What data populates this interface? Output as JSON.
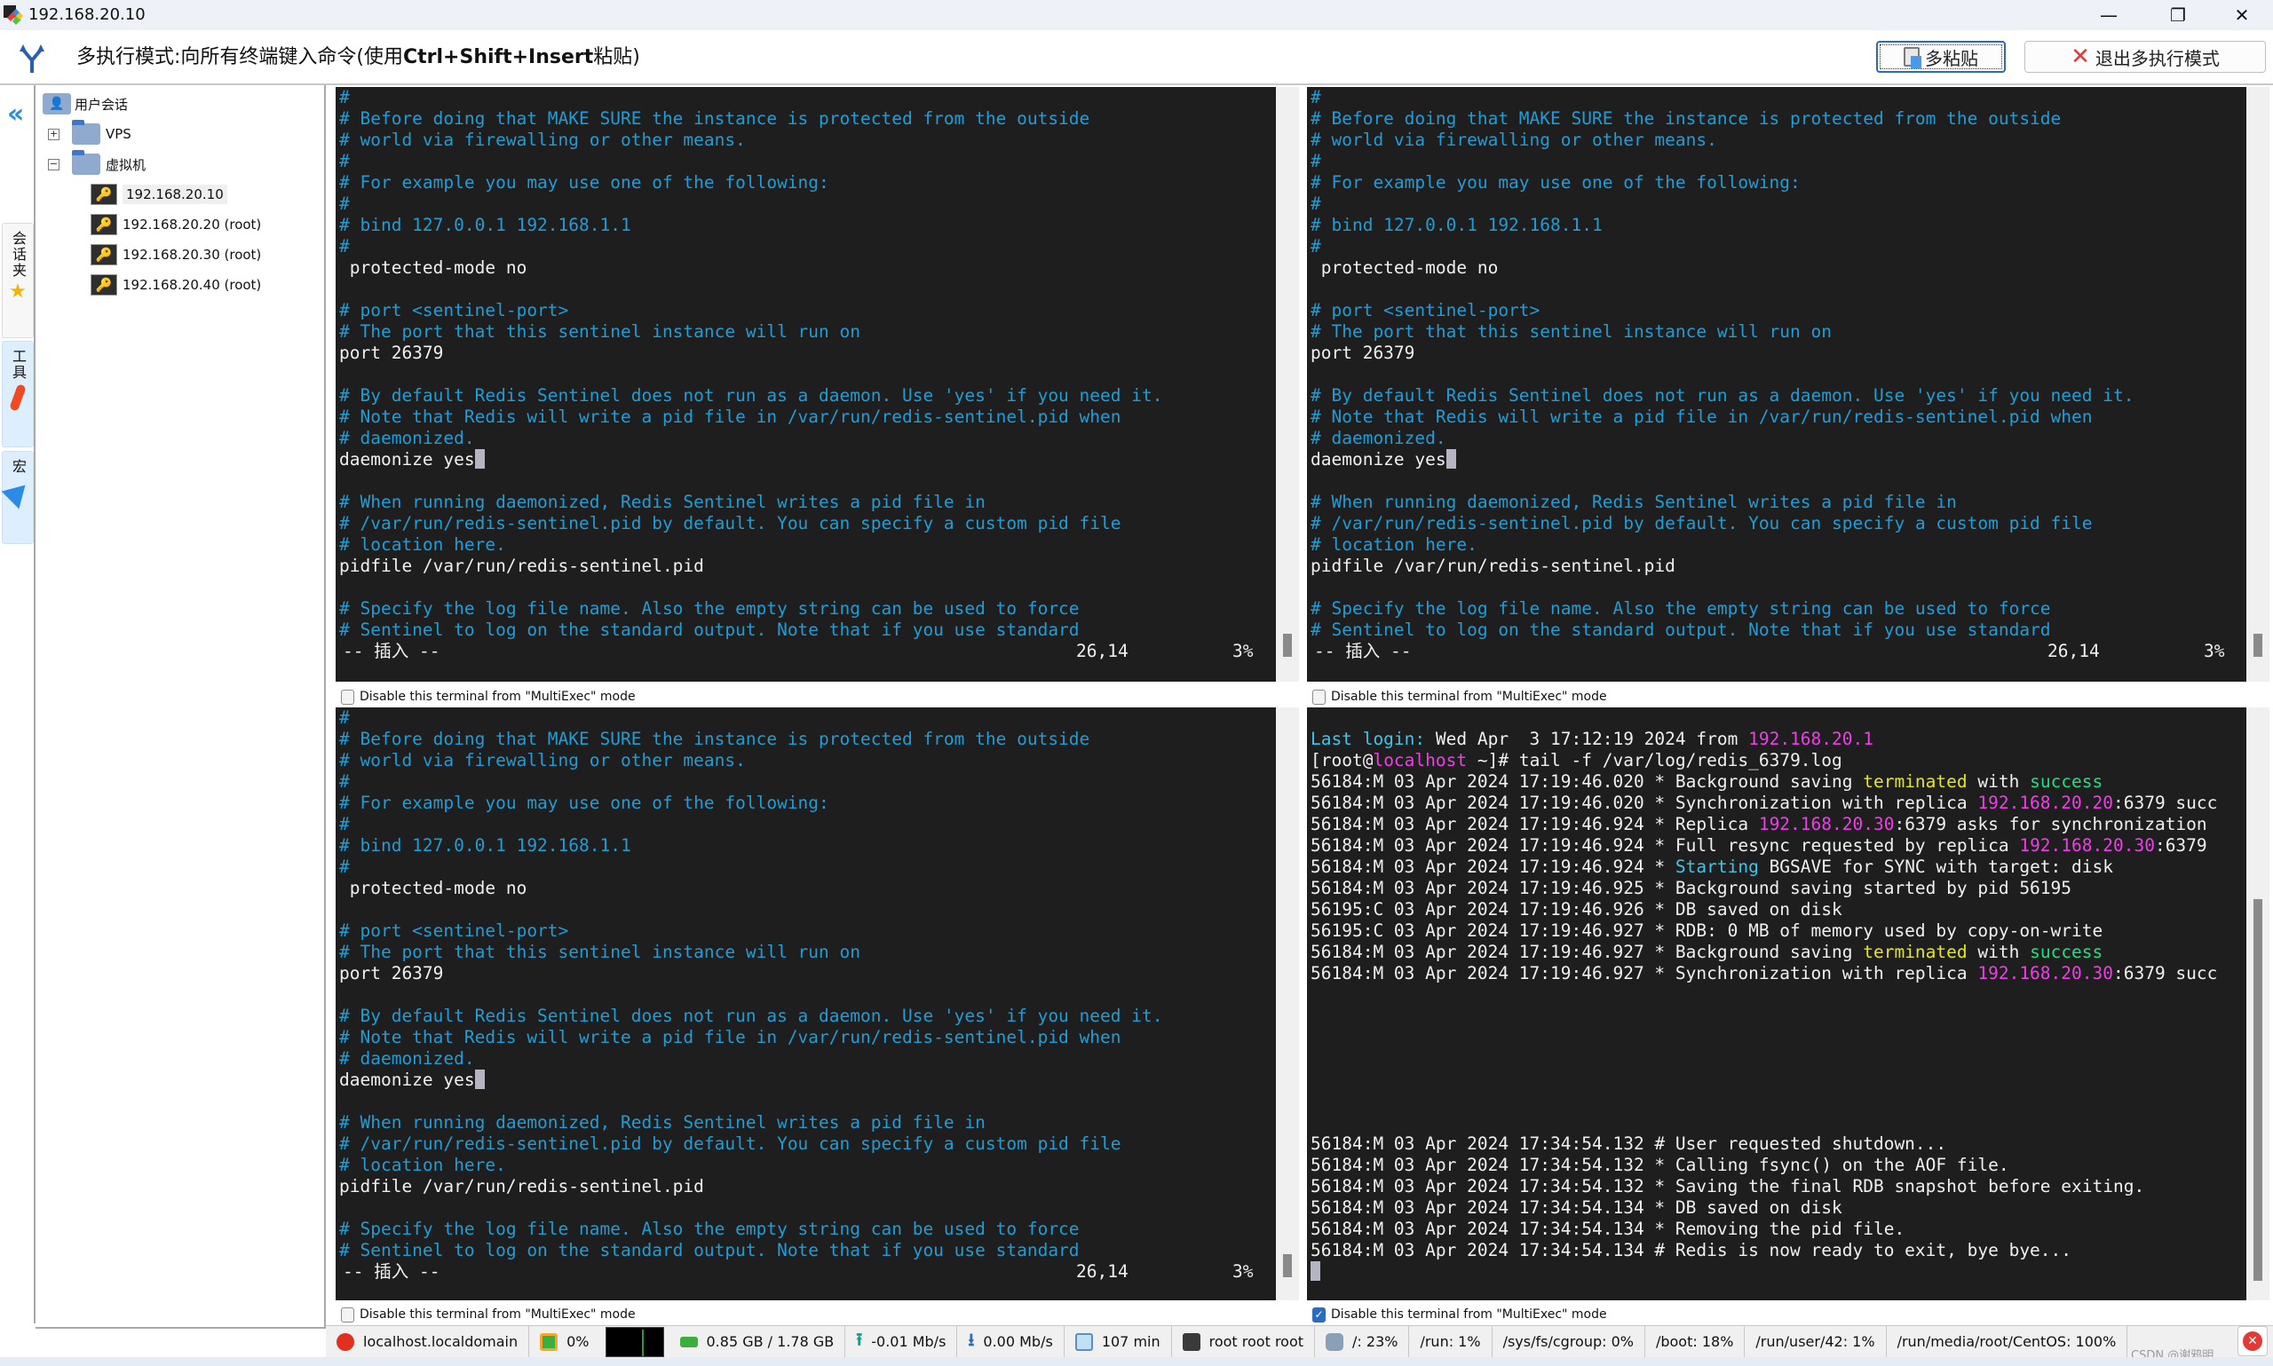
{
  "window": {
    "title": "192.168.20.10",
    "controls": {
      "minimize": "—",
      "maximize": "❐",
      "close": "✕"
    }
  },
  "banner": {
    "text_prefix": "多执行模式:向所有终端键入命令(使用",
    "text_bold": "Ctrl+Shift+Insert",
    "text_suffix": "粘贴)",
    "paste_button": "多粘贴",
    "exit_button": "退出多执行模式"
  },
  "vtabs": {
    "collapse": "«",
    "sessions": "会话夹",
    "tools": "工具",
    "macros": "宏"
  },
  "tree": {
    "root": "用户会话",
    "folders": [
      {
        "label": "VPS",
        "expander": "+"
      },
      {
        "label": "虚拟机",
        "expander": "−"
      }
    ],
    "sessions": [
      {
        "label": "192.168.20.10",
        "selected": true
      },
      {
        "label": "192.168.20.20 (root)",
        "selected": false
      },
      {
        "label": "192.168.20.30 (root)",
        "selected": false
      },
      {
        "label": "192.168.20.40 (root)",
        "selected": false
      }
    ]
  },
  "vim_pane": {
    "lines": [
      {
        "t": "#",
        "c": "cmt"
      },
      {
        "t": "# Before doing that MAKE SURE the instance is protected from the outside",
        "c": "cmt"
      },
      {
        "t": "# world via firewalling or other means.",
        "c": "cmt"
      },
      {
        "t": "#",
        "c": "cmt"
      },
      {
        "t": "# For example you may use one of the following:",
        "c": "cmt"
      },
      {
        "t": "#",
        "c": "cmt"
      },
      {
        "t": "# bind 127.0.0.1 192.168.1.1",
        "c": "cmt"
      },
      {
        "t": "#",
        "c": "cmt"
      },
      {
        "t": " protected-mode no",
        "c": ""
      },
      {
        "t": "",
        "c": ""
      },
      {
        "t": "# port <sentinel-port>",
        "c": "cmt"
      },
      {
        "t": "# The port that this sentinel instance will run on",
        "c": "cmt"
      },
      {
        "t": "port 26379",
        "c": ""
      },
      {
        "t": "",
        "c": ""
      },
      {
        "t": "# By default Redis Sentinel does not run as a daemon. Use 'yes' if you need it.",
        "c": "cmt"
      },
      {
        "t": "# Note that Redis will write a pid file in /var/run/redis-sentinel.pid when",
        "c": "cmt"
      },
      {
        "t": "# daemonized.",
        "c": "cmt"
      },
      {
        "t": "daemonize yes",
        "c": "",
        "cursor": true
      },
      {
        "t": "",
        "c": ""
      },
      {
        "t": "# When running daemonized, Redis Sentinel writes a pid file in",
        "c": "cmt"
      },
      {
        "t": "# /var/run/redis-sentinel.pid by default. You can specify a custom pid file",
        "c": "cmt"
      },
      {
        "t": "# location here.",
        "c": "cmt"
      },
      {
        "t": "pidfile /var/run/redis-sentinel.pid",
        "c": ""
      },
      {
        "t": "",
        "c": ""
      },
      {
        "t": "# Specify the log file name. Also the empty string can be used to force",
        "c": "cmt"
      },
      {
        "t": "# Sentinel to log on the standard output. Note that if you use standard",
        "c": "cmt"
      }
    ],
    "status_mode": "-- 插入 --",
    "status_pos": "26,14",
    "status_pct": "3%",
    "scroll_position": 0.03
  },
  "multiexec_checkbox": {
    "label": "Disable this terminal from \"MultiExec\" mode",
    "pane_1": false,
    "pane_2": false,
    "pane_3": false,
    "pane_4": true
  },
  "log_pane": {
    "lines": [
      [],
      [
        {
          "t": "Last login:",
          "c": "cyan"
        },
        {
          "t": " Wed Apr  3 17:12:19 2024 from "
        },
        {
          "t": "192.168.20.1",
          "c": "pink"
        }
      ],
      [
        {
          "t": "[root@"
        },
        {
          "t": "localhost",
          "c": "pink"
        },
        {
          "t": " ~]# tail -f /var/log/redis_6379.log"
        }
      ],
      [
        {
          "t": "56184:M 03 Apr 2024 17:19:46.020 * Background saving "
        },
        {
          "t": "terminated",
          "c": "yel"
        },
        {
          "t": " with "
        },
        {
          "t": "success",
          "c": "grn"
        }
      ],
      [
        {
          "t": "56184:M 03 Apr 2024 17:19:46.020 * Synchronization with replica "
        },
        {
          "t": "192.168.20.20",
          "c": "pink"
        },
        {
          "t": ":6379 succ"
        }
      ],
      [
        {
          "t": "56184:M 03 Apr 2024 17:19:46.924 * Replica "
        },
        {
          "t": "192.168.20.30",
          "c": "pink"
        },
        {
          "t": ":6379 asks for synchronization"
        }
      ],
      [
        {
          "t": "56184:M 03 Apr 2024 17:19:46.924 * Full resync requested by replica "
        },
        {
          "t": "192.168.20.30",
          "c": "pink"
        },
        {
          "t": ":6379"
        }
      ],
      [
        {
          "t": "56184:M 03 Apr 2024 17:19:46.924 * "
        },
        {
          "t": "Starting",
          "c": "cyan"
        },
        {
          "t": " BGSAVE for SYNC with target: disk"
        }
      ],
      [
        {
          "t": "56184:M 03 Apr 2024 17:19:46.925 * Background saving started by pid 56195"
        }
      ],
      [
        {
          "t": "56195:C 03 Apr 2024 17:19:46.926 * DB saved on disk"
        }
      ],
      [
        {
          "t": "56195:C 03 Apr 2024 17:19:46.927 * RDB: 0 MB of memory used by copy-on-write"
        }
      ],
      [
        {
          "t": "56184:M 03 Apr 2024 17:19:46.927 * Background saving "
        },
        {
          "t": "terminated",
          "c": "yel"
        },
        {
          "t": " with "
        },
        {
          "t": "success",
          "c": "grn"
        }
      ],
      [
        {
          "t": "56184:M 03 Apr 2024 17:19:46.927 * Synchronization with replica "
        },
        {
          "t": "192.168.20.30",
          "c": "pink"
        },
        {
          "t": ":6379 succ"
        }
      ],
      [],
      [],
      [],
      [],
      [],
      [],
      [],
      [
        {
          "t": "56184:M 03 Apr 2024 17:34:54.132 # User requested shutdown..."
        }
      ],
      [
        {
          "t": "56184:M 03 Apr 2024 17:34:54.132 * Calling fsync() on the AOF file."
        }
      ],
      [
        {
          "t": "56184:M 03 Apr 2024 17:34:54.132 * Saving the final RDB snapshot before exiting."
        }
      ],
      [
        {
          "t": "56184:M 03 Apr 2024 17:34:54.134 * DB saved on disk"
        }
      ],
      [
        {
          "t": "56184:M 03 Apr 2024 17:34:54.134 * Removing the pid file."
        }
      ],
      [
        {
          "t": "56184:M 03 Apr 2024 17:34:54.134 # Redis is now ready to exit, bye bye..."
        }
      ],
      [
        {
          "cursor": true
        }
      ]
    ],
    "scroll_position": 0.9
  },
  "statusbar": {
    "hostname": "localhost.localdomain",
    "cpu": "0%",
    "memory": "0.85 GB / 1.78 GB",
    "upload": "-0.01 Mb/s",
    "download": "0.00 Mb/s",
    "uptime": "107 min",
    "users": "root  root  root",
    "disks": [
      "/: 23%",
      "/run: 1%",
      "/sys/fs/cgroup: 0%",
      "/boot: 18%",
      "/run/user/42: 1%",
      "/run/media/root/CentOS: 100%"
    ]
  },
  "watermark": "CSDN @谢鸦明",
  "colors": {
    "terminal_bg": "#1e1e1e",
    "comment": "#1f9dd6",
    "ip_highlight": "#ee3ee8",
    "warning_word": "#e6e61c",
    "success_word": "#1fe086",
    "accent_blue": "#2d8ae6"
  }
}
